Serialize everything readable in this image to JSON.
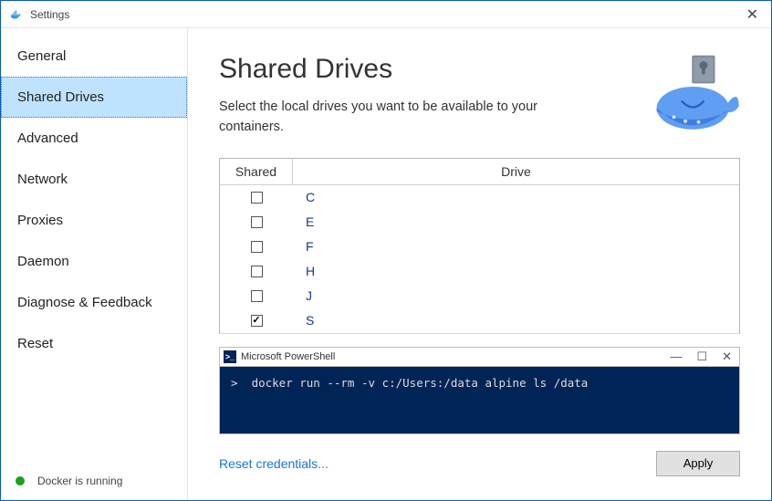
{
  "window": {
    "title": "Settings"
  },
  "sidebar": {
    "items": [
      {
        "label": "General"
      },
      {
        "label": "Shared Drives"
      },
      {
        "label": "Advanced"
      },
      {
        "label": "Network"
      },
      {
        "label": "Proxies"
      },
      {
        "label": "Daemon"
      },
      {
        "label": "Diagnose & Feedback"
      },
      {
        "label": "Reset"
      }
    ],
    "activeIndex": 1
  },
  "status": {
    "text": "Docker is running"
  },
  "page": {
    "title": "Shared Drives",
    "subtitle": "Select the local drives you want to be available to your containers."
  },
  "table": {
    "headers": {
      "shared": "Shared",
      "drive": "Drive"
    },
    "rows": [
      {
        "drive": "C",
        "shared": false
      },
      {
        "drive": "E",
        "shared": false
      },
      {
        "drive": "F",
        "shared": false
      },
      {
        "drive": "H",
        "shared": false
      },
      {
        "drive": "J",
        "shared": false
      },
      {
        "drive": "S",
        "shared": true
      }
    ]
  },
  "terminal": {
    "title": "Microsoft PowerShell",
    "command": ">  docker run --rm -v c:/Users:/data alpine ls /data"
  },
  "footer": {
    "reset_link": "Reset credentials...",
    "apply_label": "Apply"
  }
}
